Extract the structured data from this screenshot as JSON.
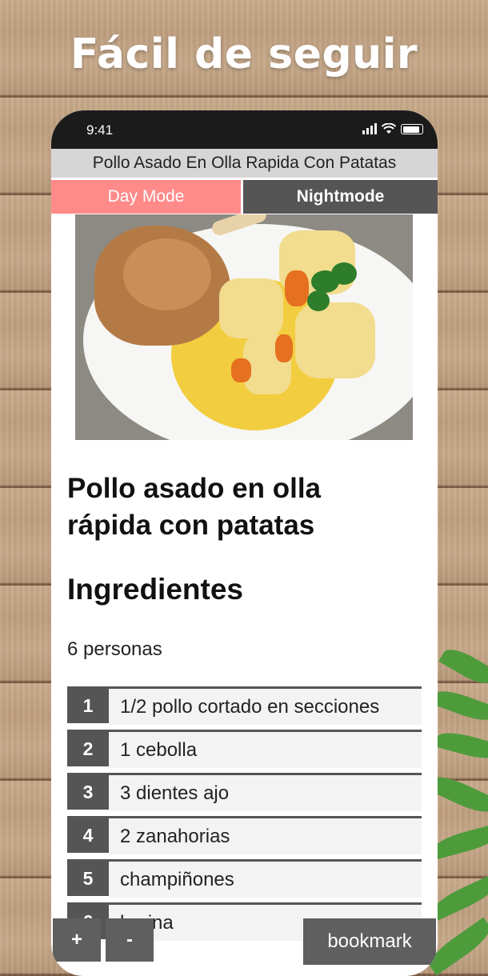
{
  "banner": {
    "headline": "Fácil de seguir"
  },
  "status_bar": {
    "time": "9:41",
    "icons": [
      "signal-icon",
      "wifi-icon",
      "battery-icon"
    ]
  },
  "app": {
    "title": "Pollo Asado En Olla Rapida Con Patatas",
    "modes": {
      "day_label": "Day Mode",
      "night_label": "Nightmode",
      "active": "Day Mode"
    }
  },
  "recipe": {
    "title": "Pollo asado en olla rápida con patatas",
    "section_title": "Ingredientes",
    "servings": "6 personas",
    "ingredients": [
      {
        "num": "1",
        "text": "1/2 pollo cortado en secciones"
      },
      {
        "num": "2",
        "text": "1 cebolla"
      },
      {
        "num": "3",
        "text": "3 dientes ajo"
      },
      {
        "num": "4",
        "text": "2 zanahorias"
      },
      {
        "num": "5",
        "text": "champiñones"
      },
      {
        "num": "6",
        "text": "harina"
      }
    ]
  },
  "controls": {
    "zoom_in": "+",
    "zoom_out": "-",
    "bookmark": "bookmark"
  },
  "colors": {
    "day_mode": "#ff8a8a",
    "night_mode": "#555555",
    "title_bar": "#d6d6d6"
  }
}
